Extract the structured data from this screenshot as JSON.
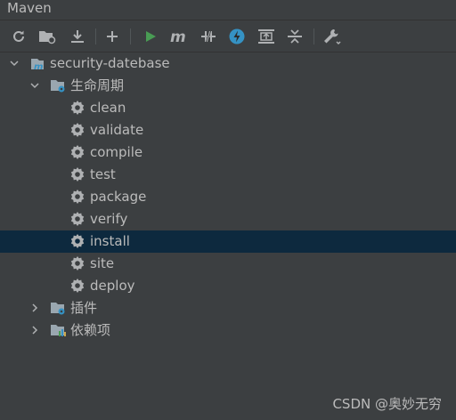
{
  "window": {
    "title": "Maven"
  },
  "toolbar": {
    "buttons": [
      {
        "name": "reload-icon"
      },
      {
        "name": "add-folder-icon"
      },
      {
        "name": "download-icon"
      },
      {
        "name": "add-icon"
      },
      {
        "name": "run-icon"
      },
      {
        "name": "execute-goal-icon"
      },
      {
        "name": "toggle-offline-icon"
      },
      {
        "name": "skip-tests-icon"
      },
      {
        "name": "show-dependencies-icon"
      },
      {
        "name": "collapse-all-icon"
      },
      {
        "name": "settings-wrench-icon"
      }
    ]
  },
  "tree": {
    "project": "security-datebase",
    "lifecycle": {
      "label": "生命周期",
      "goals": [
        "clean",
        "validate",
        "compile",
        "test",
        "package",
        "verify",
        "install",
        "site",
        "deploy"
      ],
      "selected": "install"
    },
    "plugins": "插件",
    "dependencies": "依赖项"
  },
  "watermark": "CSDN @奥妙无穷",
  "colors": {
    "background": "#3c3f41",
    "selection": "#0d293e",
    "text": "#bbbbbb",
    "run_green": "#499c54",
    "accent_blue": "#3592c4"
  }
}
